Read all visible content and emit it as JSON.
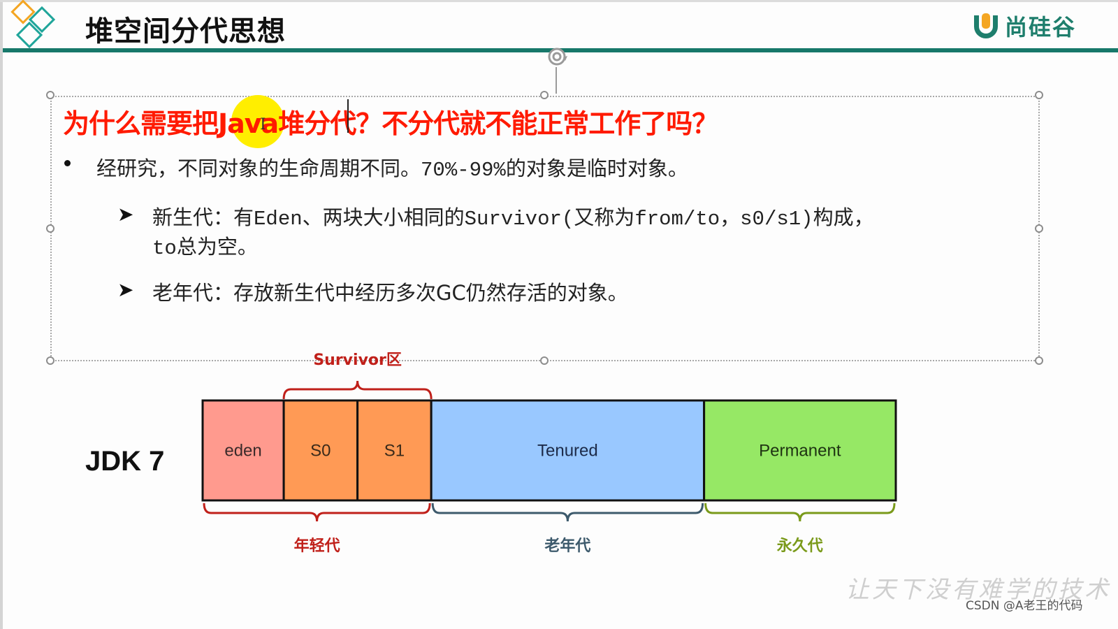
{
  "slide": {
    "title": "堆空间分代思想",
    "brand": {
      "name": "尚硅谷",
      "logo_icon": "u-logo-icon"
    },
    "colors": {
      "title_rule": "#17786a",
      "question": "#ff1a00",
      "highlight": "#ffee00",
      "eden": "#ff9a8e",
      "survivor": "#ff9a55",
      "tenured": "#99c8ff",
      "permanent": "#96e865",
      "young_brace": "#c0201a",
      "old_brace": "#3d5a6c",
      "perm_brace": "#7a9a1a"
    }
  },
  "question": "为什么需要把Java堆分代？不分代就不能正常工作了吗？",
  "bullets": [
    {
      "marker": "bullet-dot",
      "prefix": "经研究，不同对象的生命周期不同。",
      "mono": "70%-99%",
      "suffix": "的对象是临时对象。"
    }
  ],
  "sub_bullets": [
    {
      "marker": "arrow-icon",
      "line1_parts": [
        "新生代：有",
        "Eden",
        "、两块大小相同的",
        "Survivor(",
        "又称为",
        "from/to，s0/s1)",
        "构成，"
      ],
      "line2_parts": [
        "to",
        "总为空。"
      ]
    },
    {
      "marker": "arrow-icon",
      "text": "老年代：存放新生代中经历多次GC仍然存活的对象。"
    }
  ],
  "chart_data": {
    "type": "diagram",
    "title": "JDK 7",
    "segments": [
      {
        "label": "eden",
        "relative_size": 1.1
      },
      {
        "label": "S0",
        "relative_size": 1.0
      },
      {
        "label": "S1",
        "relative_size": 1.0
      },
      {
        "label": "Tenured",
        "relative_size": 3.7
      },
      {
        "label": "Permanent",
        "relative_size": 2.6
      }
    ],
    "top_braces": [
      {
        "label": "Survivor区",
        "spans": [
          "S0",
          "S1"
        ]
      }
    ],
    "bottom_braces": [
      {
        "label": "年轻代",
        "spans": [
          "eden",
          "S0",
          "S1"
        ]
      },
      {
        "label": "老年代",
        "spans": [
          "Tenured"
        ]
      },
      {
        "label": "永久代",
        "spans": [
          "Permanent"
        ]
      }
    ]
  },
  "watermark": "让天下没有难学的技术",
  "credit": "CSDN @A老王的代码"
}
